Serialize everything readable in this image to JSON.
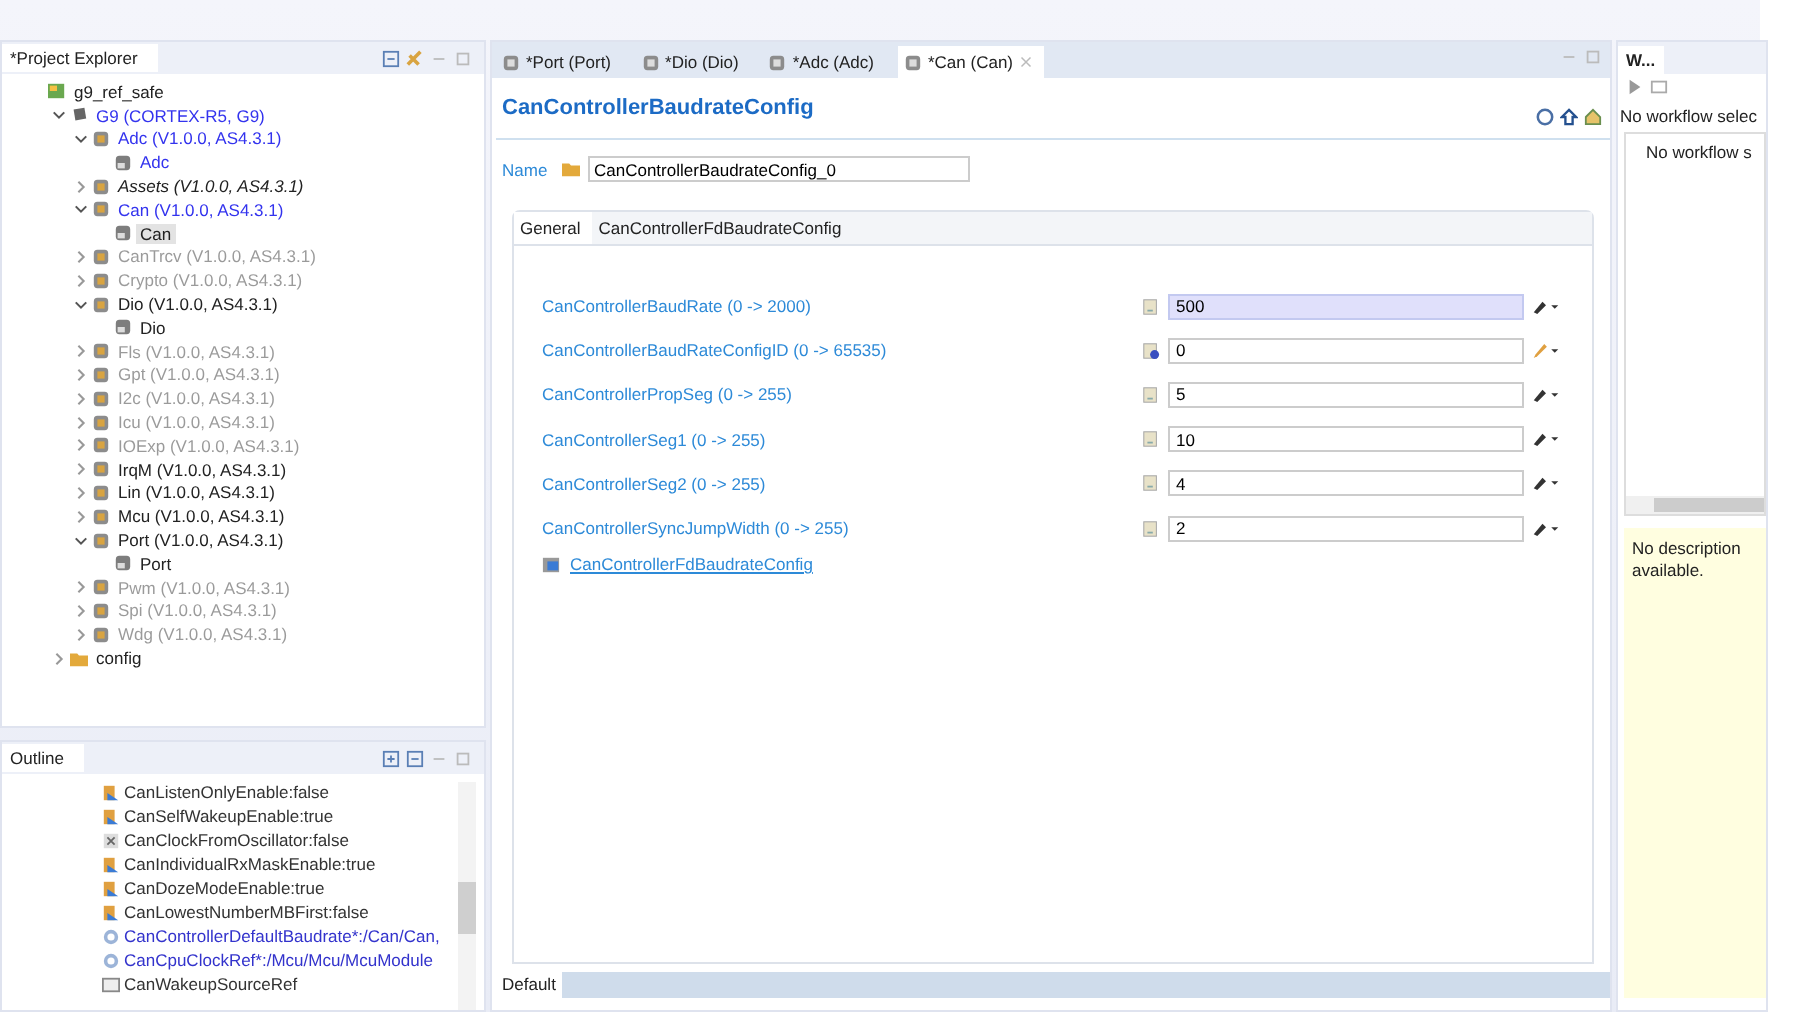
{
  "project_explorer": {
    "title": "*Project Explorer",
    "tree": [
      {
        "label": "g9_ref_safe",
        "kind": "project",
        "modified": false,
        "disabled": false,
        "derived": false,
        "selected": false,
        "children": [
          {
            "label": "G9 (CORTEX-R5, G9)",
            "kind": "ecu",
            "modified": true,
            "disabled": false,
            "derived": false,
            "selected": false,
            "expanded": true,
            "children": [
              {
                "label": "Adc (V1.0.0, AS4.3.1)",
                "kind": "module",
                "modified": true,
                "disabled": false,
                "derived": false,
                "selected": false,
                "expanded": true,
                "children": [
                  {
                    "label": "Adc",
                    "kind": "config",
                    "modified": true,
                    "disabled": false,
                    "derived": false,
                    "selected": false
                  }
                ]
              },
              {
                "label": "Assets (V1.0.0, AS4.3.1)",
                "kind": "module",
                "modified": false,
                "disabled": false,
                "derived": true,
                "selected": false,
                "expanded": false
              },
              {
                "label": "Can (V1.0.0, AS4.3.1)",
                "kind": "module",
                "modified": true,
                "disabled": false,
                "derived": false,
                "selected": false,
                "expanded": true,
                "children": [
                  {
                    "label": "Can",
                    "kind": "config",
                    "modified": false,
                    "disabled": false,
                    "derived": false,
                    "selected": true
                  }
                ]
              },
              {
                "label": "CanTrcv (V1.0.0, AS4.3.1)",
                "kind": "module",
                "modified": false,
                "disabled": true,
                "derived": false,
                "selected": false,
                "expanded": false
              },
              {
                "label": "Crypto (V1.0.0, AS4.3.1)",
                "kind": "module",
                "modified": false,
                "disabled": true,
                "derived": false,
                "selected": false,
                "expanded": false
              },
              {
                "label": "Dio (V1.0.0, AS4.3.1)",
                "kind": "module",
                "modified": false,
                "disabled": false,
                "derived": false,
                "selected": false,
                "expanded": true,
                "children": [
                  {
                    "label": "Dio",
                    "kind": "config",
                    "modified": false,
                    "disabled": false,
                    "derived": false,
                    "selected": false
                  }
                ]
              },
              {
                "label": "Fls (V1.0.0, AS4.3.1)",
                "kind": "module",
                "modified": false,
                "disabled": true,
                "derived": false,
                "selected": false,
                "expanded": false
              },
              {
                "label": "Gpt (V1.0.0, AS4.3.1)",
                "kind": "module",
                "modified": false,
                "disabled": true,
                "derived": false,
                "selected": false,
                "expanded": false
              },
              {
                "label": "I2c (V1.0.0, AS4.3.1)",
                "kind": "module",
                "modified": false,
                "disabled": true,
                "derived": false,
                "selected": false,
                "expanded": false
              },
              {
                "label": "Icu (V1.0.0, AS4.3.1)",
                "kind": "module",
                "modified": false,
                "disabled": true,
                "derived": false,
                "selected": false,
                "expanded": false
              },
              {
                "label": "IOExp (V1.0.0, AS4.3.1)",
                "kind": "module",
                "modified": false,
                "disabled": true,
                "derived": false,
                "selected": false,
                "expanded": false
              },
              {
                "label": "IrqM (V1.0.0, AS4.3.1)",
                "kind": "module",
                "modified": false,
                "disabled": false,
                "derived": false,
                "selected": false,
                "expanded": false
              },
              {
                "label": "Lin (V1.0.0, AS4.3.1)",
                "kind": "module",
                "modified": false,
                "disabled": false,
                "derived": false,
                "selected": false,
                "expanded": false
              },
              {
                "label": "Mcu (V1.0.0, AS4.3.1)",
                "kind": "module",
                "modified": false,
                "disabled": false,
                "derived": false,
                "selected": false,
                "expanded": false
              },
              {
                "label": "Port (V1.0.0, AS4.3.1)",
                "kind": "module",
                "modified": false,
                "disabled": false,
                "derived": false,
                "selected": false,
                "expanded": true,
                "children": [
                  {
                    "label": "Port",
                    "kind": "config",
                    "modified": false,
                    "disabled": false,
                    "derived": false,
                    "selected": false
                  }
                ]
              },
              {
                "label": "Pwm (V1.0.0, AS4.3.1)",
                "kind": "module",
                "modified": false,
                "disabled": true,
                "derived": false,
                "selected": false,
                "expanded": false
              },
              {
                "label": "Spi (V1.0.0, AS4.3.1)",
                "kind": "module",
                "modified": false,
                "disabled": true,
                "derived": false,
                "selected": false,
                "expanded": false
              },
              {
                "label": "Wdg (V1.0.0, AS4.3.1)",
                "kind": "module",
                "modified": false,
                "disabled": true,
                "derived": false,
                "selected": false,
                "expanded": false
              }
            ]
          },
          {
            "label": "config",
            "kind": "folder",
            "modified": false,
            "disabled": false,
            "derived": false,
            "selected": false,
            "expanded": false
          }
        ]
      }
    ]
  },
  "outline": {
    "title": "Outline",
    "items": [
      {
        "label": "CanListenOnlyEnable:false",
        "kind": "boolean"
      },
      {
        "label": "CanSelfWakeupEnable:true",
        "kind": "boolean"
      },
      {
        "label": "CanClockFromOscillator:false",
        "kind": "unset"
      },
      {
        "label": "CanIndividualRxMaskEnable:true",
        "kind": "boolean"
      },
      {
        "label": "CanDozeModeEnable:true",
        "kind": "boolean"
      },
      {
        "label": "CanLowestNumberMBFirst:false",
        "kind": "boolean"
      },
      {
        "label": "CanControllerDefaultBaudrate*:/Can/Can,",
        "kind": "reference"
      },
      {
        "label": "CanCpuClockRef*:/Mcu/Mcu/McuModule",
        "kind": "reference"
      },
      {
        "label": "CanWakeupSourceRef",
        "kind": "empty"
      }
    ]
  },
  "editor": {
    "tabs": [
      {
        "label": "*Port (Port)",
        "selected": false
      },
      {
        "label": "*Dio (Dio)",
        "selected": false
      },
      {
        "label": "*Adc (Adc)",
        "selected": false
      },
      {
        "label": "*Can (Can)",
        "selected": true
      }
    ],
    "title": "CanControllerBaudrateConfig",
    "name_label": "Name",
    "name_value": "CanControllerBaudrateConfig_0",
    "inner_tabs": [
      {
        "label": "General",
        "selected": true
      },
      {
        "label": "CanControllerFdBaudrateConfig",
        "selected": false
      }
    ],
    "params": [
      {
        "label": "CanControllerBaudRate (0 -> 2000)",
        "value": "500",
        "focused": true,
        "calculated": false,
        "kind": "wand"
      },
      {
        "label": "CanControllerBaudRateConfigID (0 -> 65535)",
        "value": "0",
        "focused": false,
        "calculated": true,
        "kind": "pencil"
      },
      {
        "label": "CanControllerPropSeg (0 -> 255)",
        "value": "5",
        "focused": false,
        "calculated": false,
        "kind": "wand"
      },
      {
        "label": "CanControllerSeg1 (0 -> 255)",
        "value": "10",
        "focused": false,
        "calculated": false,
        "kind": "wand"
      },
      {
        "label": "CanControllerSeg2 (0 -> 255)",
        "value": "4",
        "focused": false,
        "calculated": false,
        "kind": "wand"
      },
      {
        "label": "CanControllerSyncJumpWidth (0 -> 255)",
        "value": "2",
        "focused": false,
        "calculated": false,
        "kind": "wand"
      }
    ],
    "link": "CanControllerFdBaudrateConfig",
    "bottom_tabs": [
      {
        "label": "Default",
        "selected": true
      }
    ]
  },
  "workflow": {
    "tab": "W...",
    "header": "No workflow selec",
    "body": "No workflow s",
    "description": "No description available."
  }
}
